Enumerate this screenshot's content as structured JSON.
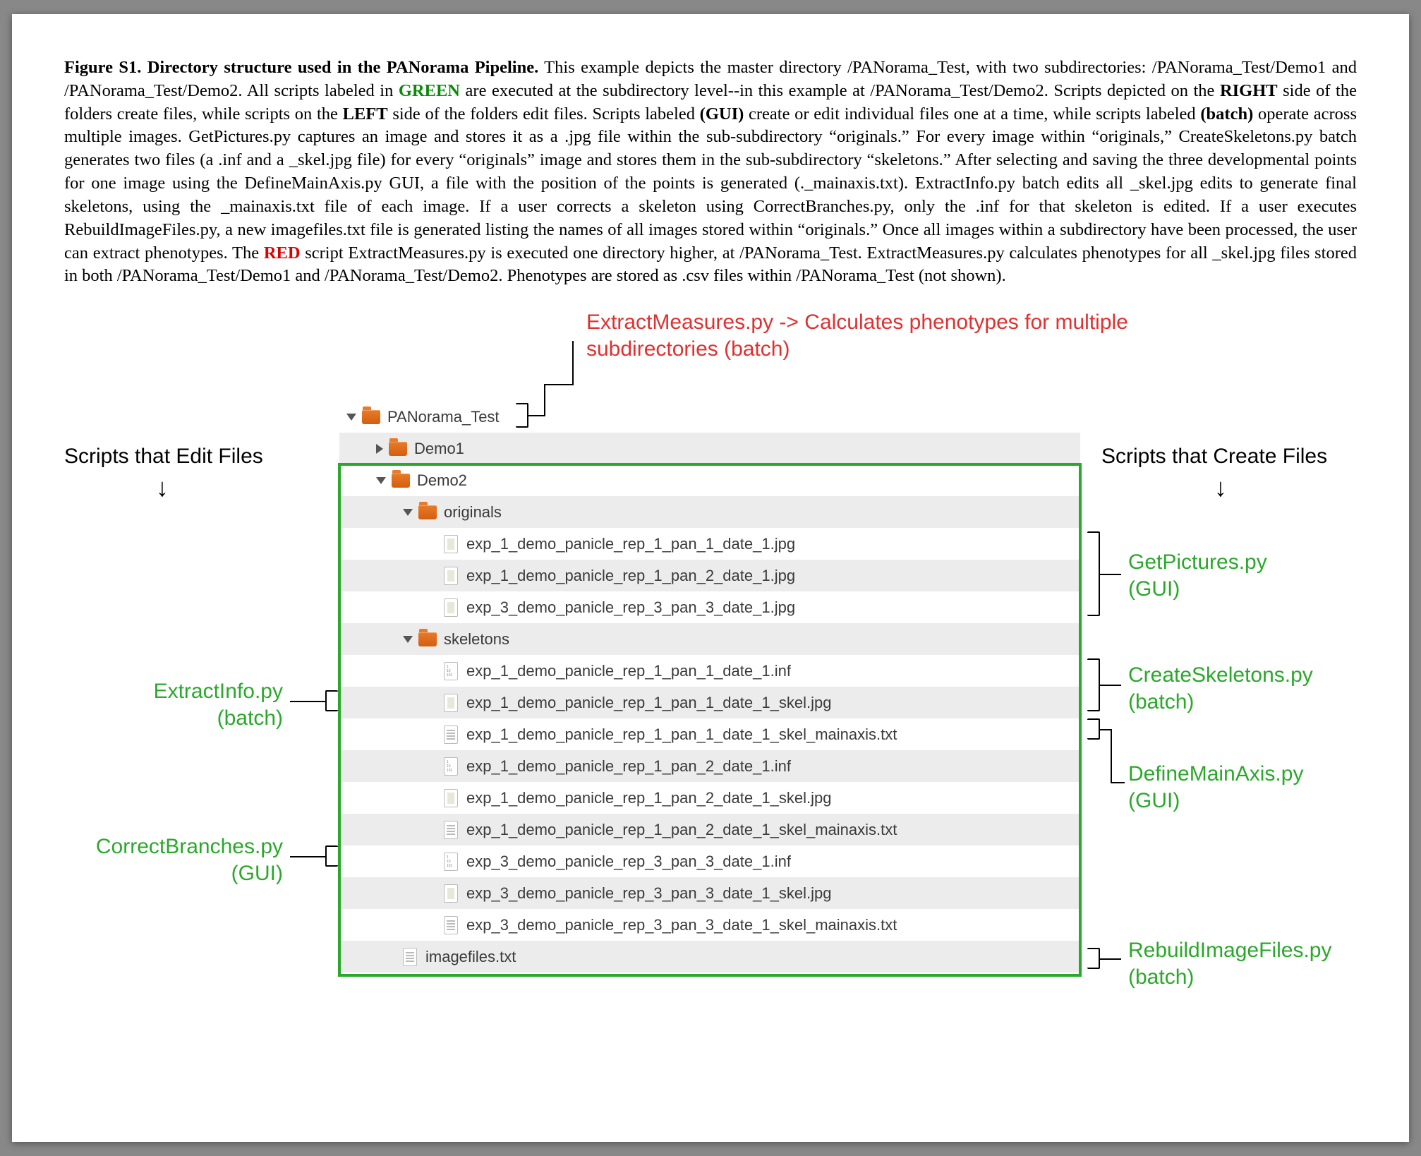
{
  "caption": {
    "title": "Figure S1.  Directory structure used in the PANorama Pipeline.",
    "body_parts": [
      " This example depicts the master directory /PANorama_Test, with two subdirectories: /PANorama_Test/Demo1 and /PANorama_Test/Demo2.  All scripts labeled in ",
      " are executed at the subdirectory level--in this example at /PANorama_Test/Demo2.  Scripts depicted on the ",
      " side of the folders create files, while scripts on the ",
      " side of the folders edit files.  Scripts labeled ",
      " create or edit individual files one at a time, while scripts labeled ",
      " operate across multiple images.   GetPictures.py captures an image and stores it as a .jpg file within the sub-subdirectory “originals.”  For every image within “originals,” CreateSkeletons.py batch generates two files (a .inf and a _skel.jpg file) for every “originals” image and stores them in the sub-subdirectory “skeletons.”  After selecting and saving the three developmental points for one image using the DefineMainAxis.py GUI, a file with the position of the points is generated (._mainaxis.txt).  ExtractInfo.py batch edits all _skel.jpg edits to generate final skeletons, using the _mainaxis.txt file of each image.  If a user corrects a skeleton using CorrectBranches.py, only the .inf for that skeleton is edited.  If a user executes RebuildImageFiles.py, a new imagefiles.txt file is generated listing the names of all images stored within “originals.”  Once all images within a subdirectory have been processed, the user can extract phenotypes.  The ",
      " script ExtractMeasures.py is executed one directory higher, at /PANorama_Test.  ExtractMeasures.py calculates phenotypes for all _skel.jpg files stored in both /PANorama_Test/Demo1 and /PANorama_Test/Demo2.  Phenotypes are stored as .csv files within /PANorama_Test (not shown)."
    ],
    "green_word": "GREEN",
    "red_word": "RED",
    "right_word": "RIGHT",
    "left_word": "LEFT",
    "gui_word": "(GUI)",
    "batch_word": "(batch)"
  },
  "labels": {
    "extract_measures": "ExtractMeasures.py -> Calculates phenotypes for multiple subdirectories (batch)",
    "edit_header": "Scripts that Edit Files",
    "create_header": "Scripts that Create Files",
    "get_pictures": "GetPictures.py",
    "get_pictures_sub": "(GUI)",
    "create_skeletons": "CreateSkeletons.py",
    "create_skeletons_sub": "(batch)",
    "define_main_axis": "DefineMainAxis.py",
    "define_main_axis_sub": "(GUI)",
    "rebuild_image_files": "RebuildImageFiles.py",
    "rebuild_image_files_sub": "(batch)",
    "extract_info": "ExtractInfo.py",
    "extract_info_sub": "(batch)",
    "correct_branches": "CorrectBranches.py",
    "correct_branches_sub": "(GUI)"
  },
  "tree": {
    "root": "PANorama_Test",
    "demo1": "Demo1",
    "demo2": "Demo2",
    "originals": "originals",
    "skeletons": "skeletons",
    "orig_files": [
      "exp_1_demo_panicle_rep_1_pan_1_date_1.jpg",
      "exp_1_demo_panicle_rep_1_pan_2_date_1.jpg",
      "exp_3_demo_panicle_rep_3_pan_3_date_1.jpg"
    ],
    "skel_files": [
      "exp_1_demo_panicle_rep_1_pan_1_date_1.inf",
      "exp_1_demo_panicle_rep_1_pan_1_date_1_skel.jpg",
      "exp_1_demo_panicle_rep_1_pan_1_date_1_skel_mainaxis.txt",
      "exp_1_demo_panicle_rep_1_pan_2_date_1.inf",
      "exp_1_demo_panicle_rep_1_pan_2_date_1_skel.jpg",
      "exp_1_demo_panicle_rep_1_pan_2_date_1_skel_mainaxis.txt",
      "exp_3_demo_panicle_rep_3_pan_3_date_1.inf",
      "exp_3_demo_panicle_rep_3_pan_3_date_1_skel.jpg",
      "exp_3_demo_panicle_rep_3_pan_3_date_1_skel_mainaxis.txt"
    ],
    "imagefiles": "imagefiles.txt"
  }
}
